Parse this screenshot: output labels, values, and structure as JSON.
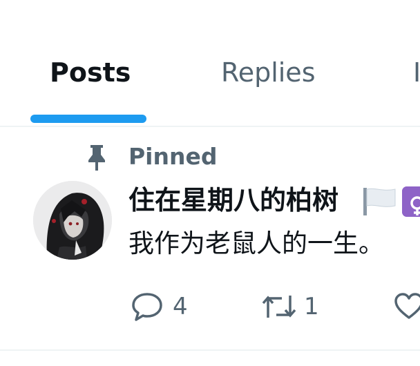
{
  "tabs": [
    {
      "label": "Posts",
      "active": true
    },
    {
      "label": "Replies",
      "active": false
    },
    {
      "label": "I",
      "active": false
    }
  ],
  "colors": {
    "accent": "#1d9bf0",
    "text_primary": "#0f1419",
    "text_secondary": "#536471",
    "divider": "#eff3f4",
    "badge": "#8e63c7"
  },
  "post": {
    "pinned_label": "Pinned",
    "display_name": "住在星期八的柏树",
    "name_icons": [
      "white-flag-icon",
      "gender-symbol-badge-icon"
    ],
    "text": "我作为老鼠人的一生。",
    "actions": {
      "reply": {
        "icon": "speech-bubble-icon",
        "count": "4"
      },
      "repost": {
        "icon": "repost-arrows-icon",
        "count": "1"
      },
      "like": {
        "icon": "heart-icon"
      }
    }
  }
}
